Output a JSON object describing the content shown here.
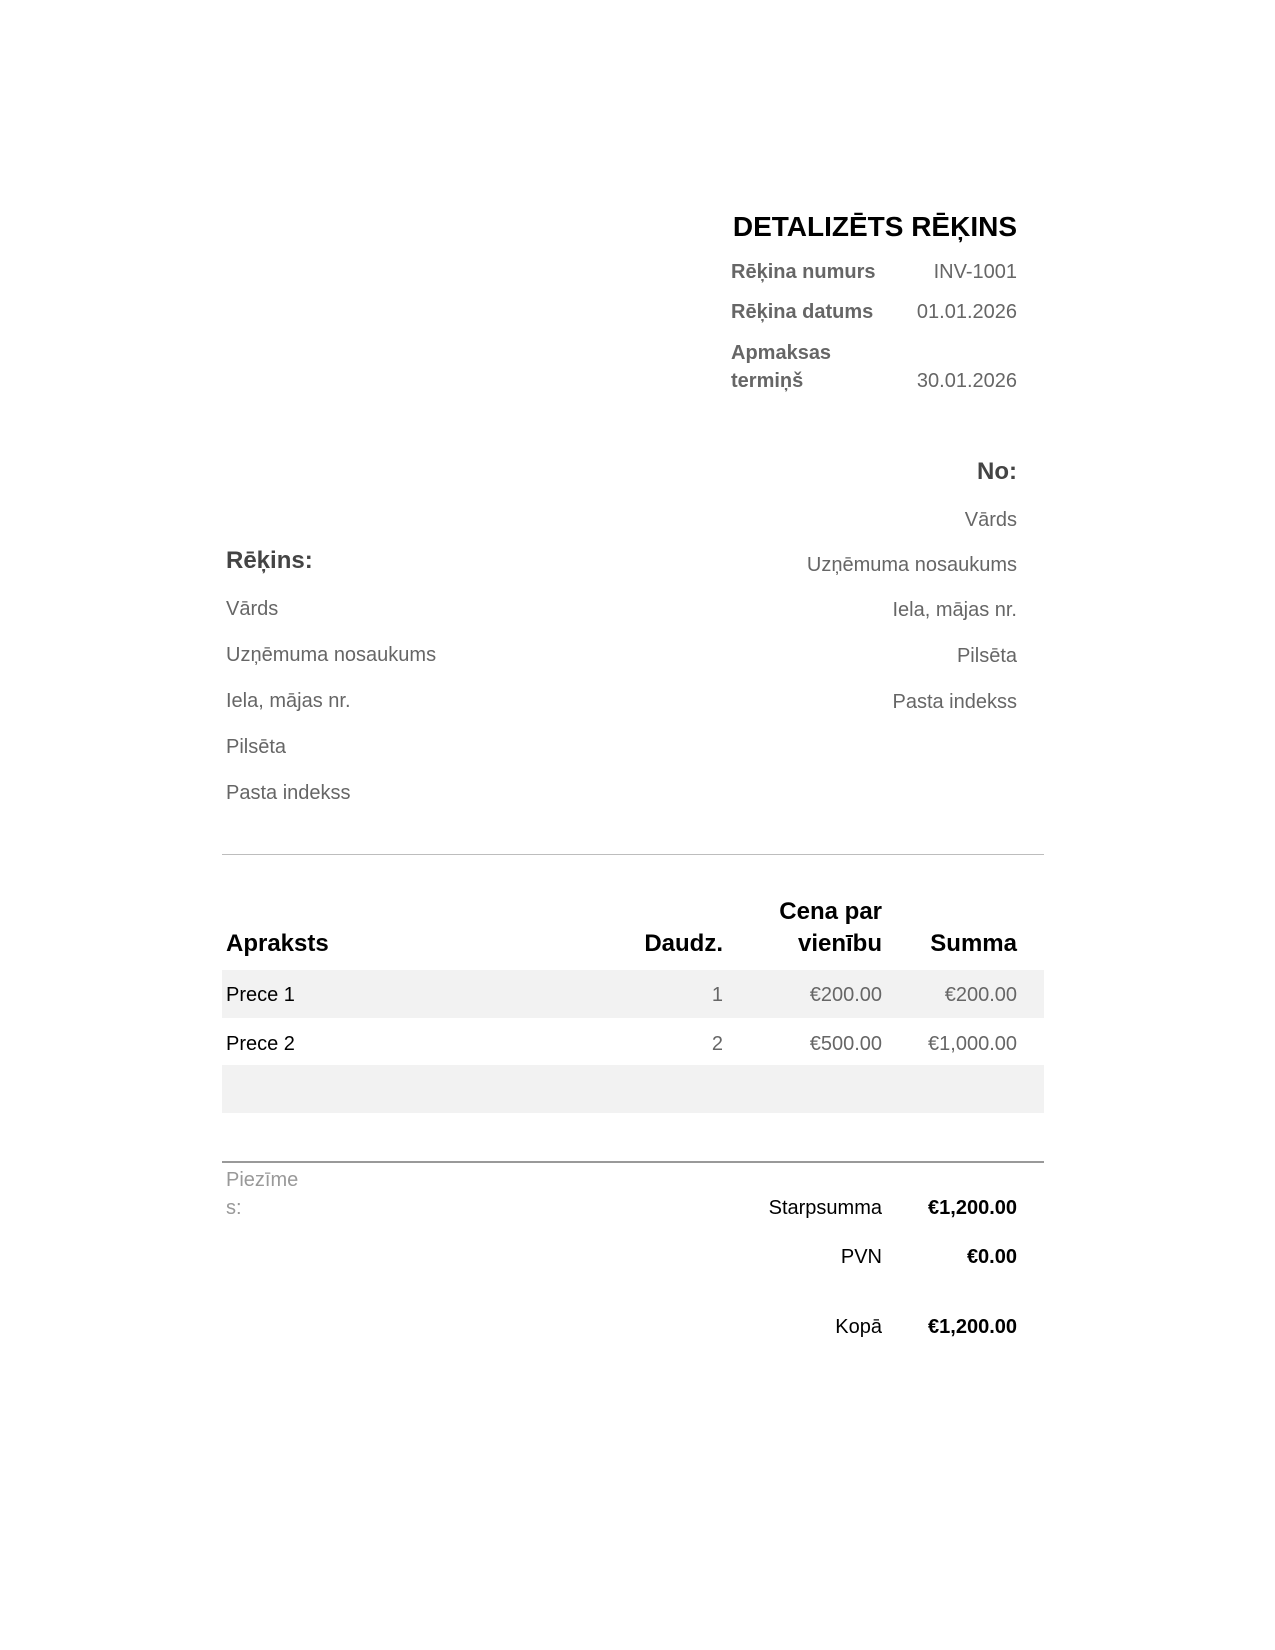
{
  "header": {
    "title": "DETALIZĒTS RĒĶINS",
    "invoice_number_label": "Rēķina numurs",
    "invoice_number": "INV-1001",
    "invoice_date_label": "Rēķina datums",
    "invoice_date": "01.01.2026",
    "due_label_line1": "Apmaksas",
    "due_label_line2": "termiņš",
    "due_date": "30.01.2026"
  },
  "from": {
    "heading": "No:",
    "name": "Vārds",
    "company": "Uzņēmuma nosaukums",
    "street": "Iela, mājas nr.",
    "city": "Pilsēta",
    "postcode": "Pasta indekss"
  },
  "bill_to": {
    "heading": "Rēķins:",
    "name": "Vārds",
    "company": "Uzņēmuma nosaukums",
    "street": "Iela, mājas nr.",
    "city": "Pilsēta",
    "postcode": "Pasta indekss"
  },
  "table": {
    "col_description": "Apraksts",
    "col_qty": "Daudz.",
    "col_unit_price_line1": "Cena par",
    "col_unit_price_line2": "vienību",
    "col_amount": "Summa",
    "rows": [
      {
        "description": "Prece 1",
        "qty": "1",
        "unit_price": "€200.00",
        "amount": "€200.00"
      },
      {
        "description": "Prece 2",
        "qty": "2",
        "unit_price": "€500.00",
        "amount": "€1,000.00"
      }
    ]
  },
  "notes": {
    "label_line1": "Piezīme",
    "label_line2": "s:"
  },
  "totals": {
    "subtotal_label": "Starpsumma",
    "subtotal": "€1,200.00",
    "vat_label": "PVN",
    "vat": "€0.00",
    "total_label": "Kopā",
    "total": "€1,200.00"
  }
}
